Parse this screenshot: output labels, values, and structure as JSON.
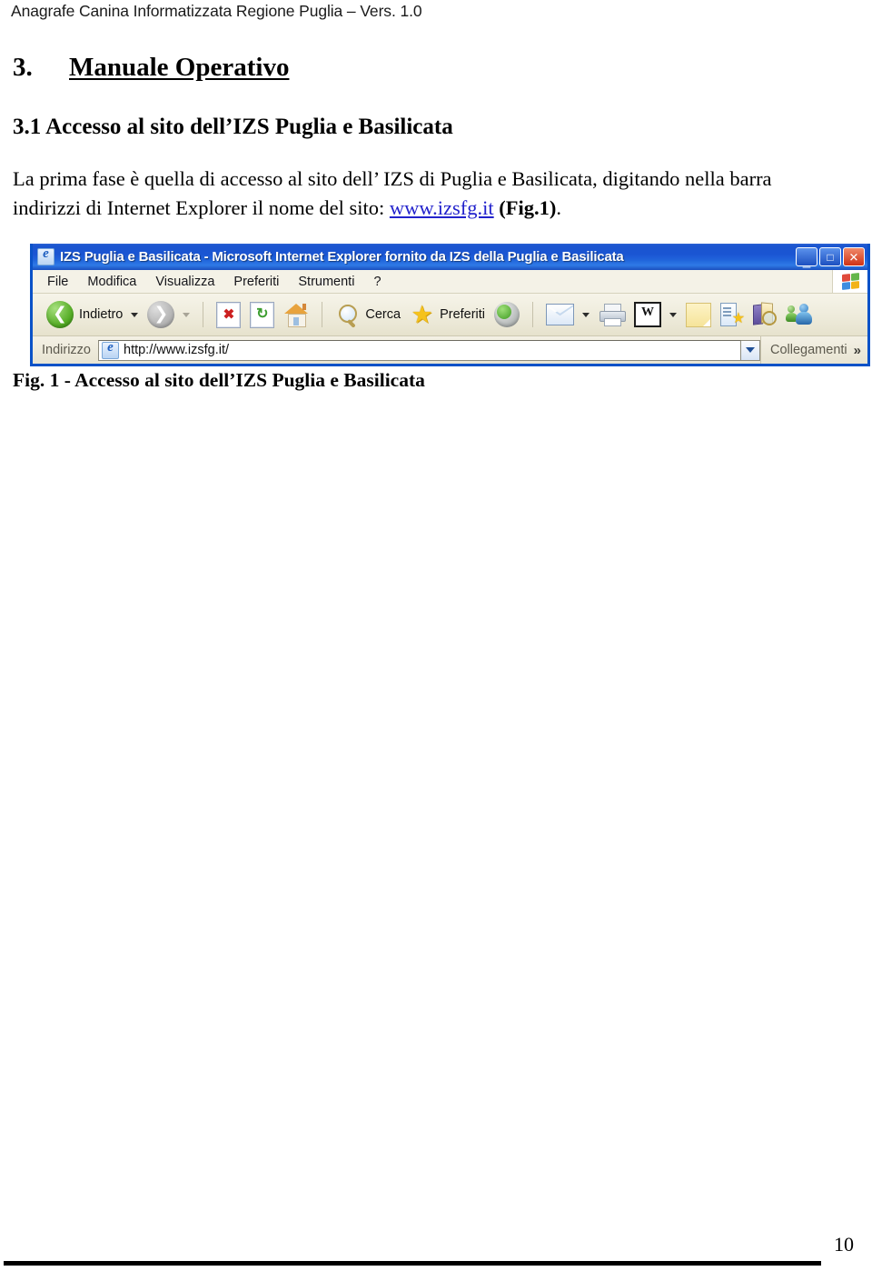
{
  "document": {
    "running_header": "Anagrafe Canina Informatizzata Regione Puglia – Vers. 1.0",
    "page_number": "10"
  },
  "content": {
    "heading1_number": "3.",
    "heading1_title": "Manuale Operativo",
    "heading2": "3.1 Accesso al sito dell’IZS Puglia e Basilicata",
    "paragraph": {
      "part1": "La prima fase è quella di accesso al sito dell’ IZS di Puglia e Basilicata, digitando nella barra indirizzi di Internet Explorer il nome del sito: ",
      "link": "www.izsfg.it",
      "part2": " ",
      "bold_ref": "(Fig.1)",
      "part3": "."
    },
    "figure_caption": "Fig. 1 - Accesso al sito dell’IZS Puglia e Basilicata"
  },
  "browser": {
    "title": "IZS Puglia e Basilicata - Microsoft Internet Explorer fornito da IZS della Puglia e Basilicata",
    "title_icon": "internet-explorer-icon",
    "window_buttons": {
      "minimize": "_",
      "maximize": "□",
      "close": "✕"
    },
    "menu": [
      {
        "label": "File"
      },
      {
        "label": "Modifica"
      },
      {
        "label": "Visualizza"
      },
      {
        "label": "Preferiti"
      },
      {
        "label": "Strumenti"
      },
      {
        "label": "?"
      }
    ],
    "toolbar": {
      "back_label": "Indietro",
      "search_label": "Cerca",
      "favorites_label": "Preferiti",
      "icons": [
        "back-arrow-icon",
        "forward-arrow-icon",
        "stop-icon",
        "refresh-icon",
        "home-icon",
        "search-icon",
        "favorites-star-icon",
        "media-icon",
        "mail-icon",
        "print-icon",
        "edit-word-icon",
        "notes-icon",
        "discuss-icon",
        "research-icon",
        "messenger-icon"
      ]
    },
    "address_bar": {
      "label": "Indirizzo",
      "url": "http://www.izsfg.it/",
      "links_label": "Collegamenti",
      "chevron": "»"
    }
  },
  "colors": {
    "titlebar_blue": "#1b55cf",
    "window_border": "#0a52c8",
    "toolbar_beige": "#ece9d8",
    "link_blue": "#2222cc",
    "close_red": "#cf3216"
  }
}
